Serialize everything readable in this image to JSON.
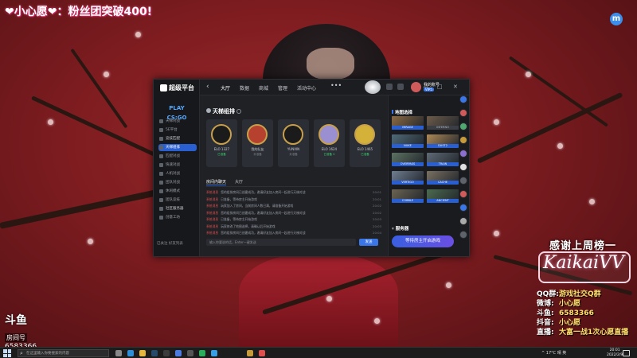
{
  "overlay": {
    "stream_title": "❤小心愿❤：粉丝团突破400!",
    "corner_logo": "m",
    "douyu_logo": "斗鱼",
    "douyu_room_label": "房间号",
    "douyu_room_id": "6583366",
    "thanks_title": "感谢上周榜一",
    "top_fan": "KaikaiVV",
    "info_rows": [
      {
        "key": "QQ群:",
        "value": "游戏社交Q群"
      },
      {
        "key": "微博:",
        "value": "小心愿"
      },
      {
        "key": "斗鱼:",
        "value": "6583366"
      },
      {
        "key": "抖音:",
        "value": "小心愿"
      },
      {
        "key": "直播:",
        "value": "大富一战1次心愿直播"
      }
    ]
  },
  "app": {
    "brand": "超级平台",
    "play_label": "PLAY CS:GO",
    "sidebar": [
      {
        "label": "天梯对战",
        "section": false,
        "active": false
      },
      {
        "label": "5E平台",
        "section": false,
        "active": false
      },
      {
        "label": "竞技匹配",
        "section": true,
        "active": false
      },
      {
        "label": "天梯组排",
        "section": false,
        "active": true
      },
      {
        "label": "匹配对战",
        "section": false,
        "active": false
      },
      {
        "label": "快速对战",
        "section": false,
        "active": false
      },
      {
        "label": "人机对战",
        "section": false,
        "active": false
      },
      {
        "label": "团队对战",
        "section": false,
        "active": false
      },
      {
        "label": "休闲模式",
        "section": false,
        "active": false
      },
      {
        "label": "团队竞技",
        "section": false,
        "active": false
      },
      {
        "label": "社区服务器",
        "section": true,
        "active": false
      },
      {
        "label": "创意工坊",
        "section": false,
        "active": false
      }
    ],
    "sidebar_bottom": "已关注  好友列表",
    "nav": [
      "大厅",
      "数据",
      "商城",
      "管理",
      "活动中心"
    ],
    "nav_more": "•••",
    "user_name": "我的账号",
    "vip": "VIP5",
    "window_controls": [
      "—",
      "□",
      "✕"
    ],
    "section_title": "天梯组排",
    "players": [
      {
        "name": "ELO 1327",
        "status": "已准备",
        "ready": true
      },
      {
        "name": "我的队友",
        "status": "未准备",
        "ready": false
      },
      {
        "name": "YUNXIN",
        "status": "未准备",
        "ready": false
      },
      {
        "name": "ELO 1624",
        "status": "已准备 V",
        "ready": true
      },
      {
        "name": "ELO 1465",
        "status": "已准备",
        "ready": true
      }
    ],
    "chat_tabs": [
      "房间内聊天",
      "大厅"
    ],
    "chat_rows": [
      {
        "who": "系统消息",
        "text": "您的组排房间已创建成功，邀请好友加入房间一起进行天梯对战",
        "time": "20:01"
      },
      {
        "who": "系统消息",
        "text": "已准备，等待房主开始游戏",
        "time": "20:01"
      },
      {
        "who": "系统消息",
        "text": "玩家加入了房间，当前房间人数已满，请准备开始游戏",
        "time": "20:02"
      },
      {
        "who": "系统消息",
        "text": "您的组排房间已创建成功，邀请好友加入房间一起进行天梯对战",
        "time": "20:02"
      },
      {
        "who": "系统消息",
        "text": "已准备，等待房主开始游戏",
        "time": "20:03"
      },
      {
        "who": "系统消息",
        "text": "玩家修改了地图选择，请确认后开始游戏",
        "time": "20:03"
      },
      {
        "who": "系统消息",
        "text": "您的组排房间已创建成功，邀请好友加入房间一起进行天梯对战",
        "time": "20:04"
      }
    ],
    "chat_placeholder": "输入你要说的话，Enter一键发送",
    "send_label": "发送",
    "map_title": "地图选择",
    "maps": [
      {
        "name": "MIRAGE",
        "selected": true,
        "color": "#8b6a44"
      },
      {
        "name": "INFERNO",
        "selected": false,
        "color": "#6d5b4a"
      },
      {
        "name": "NUKE",
        "selected": true,
        "color": "#4f6a78"
      },
      {
        "name": "DUST2",
        "selected": true,
        "color": "#b08a55"
      },
      {
        "name": "OVERPASS",
        "selected": true,
        "color": "#5c7262"
      },
      {
        "name": "TRAIN",
        "selected": true,
        "color": "#5e6a75"
      },
      {
        "name": "VERTIGO",
        "selected": true,
        "color": "#6f7e92"
      },
      {
        "name": "CACHE",
        "selected": true,
        "color": "#7a7162"
      },
      {
        "name": "COBBLE",
        "selected": true,
        "color": "#6b6452"
      },
      {
        "name": "ANCIENT",
        "selected": true,
        "color": "#4c6b4f"
      }
    ],
    "server_title": "服务器",
    "start_label": "等待房主开启游戏"
  },
  "taskbar": {
    "search_placeholder": "在这里输入你要搜索的内容",
    "tray": "^  17°C  晴  英",
    "time": "20:01",
    "date": "2022/2/9"
  }
}
